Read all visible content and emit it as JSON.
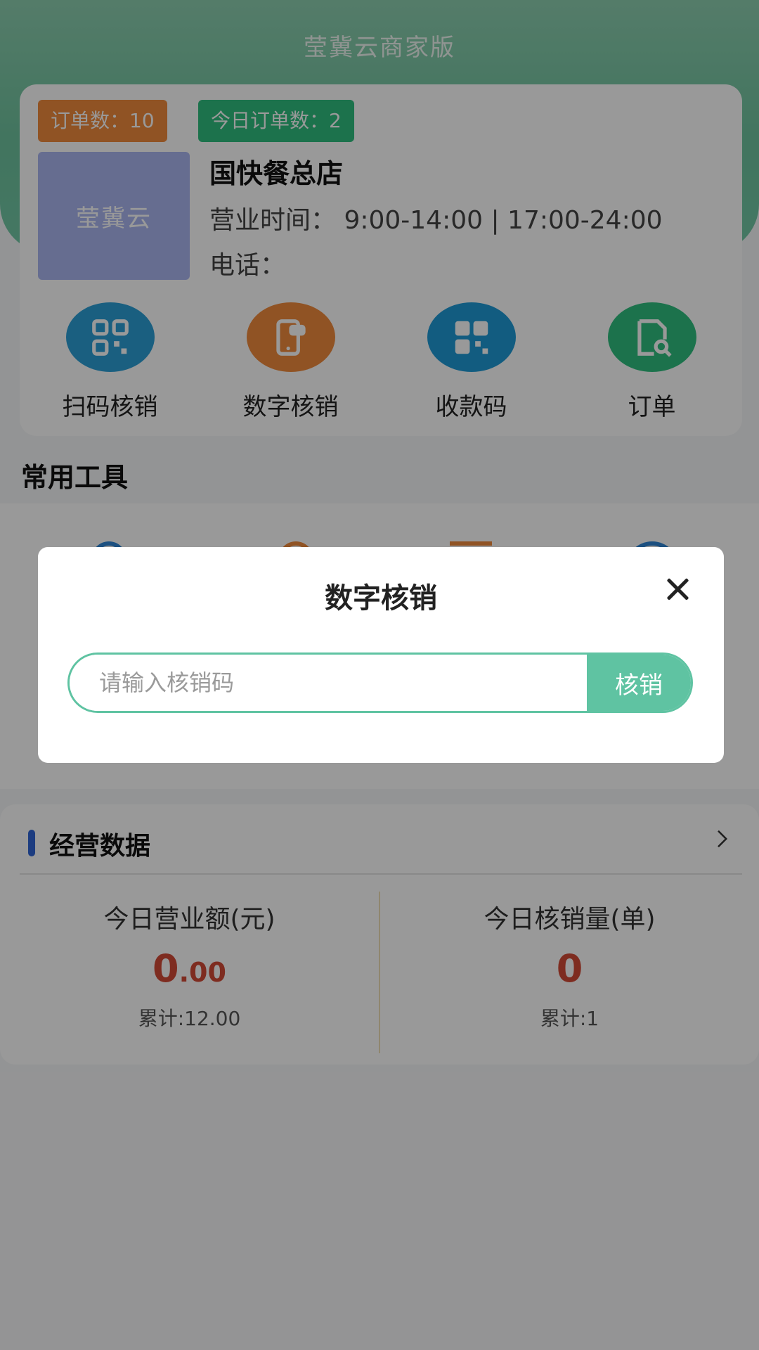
{
  "header": {
    "app_title": "莹冀云商家版"
  },
  "store": {
    "order_count_badge": "订单数：10",
    "today_order_badge": "今日订单数：2",
    "logo_text": "莹冀云",
    "name": "国快餐总店",
    "hours": "营业时间：  9:00-14:00  |  17:00-24:00",
    "phone_label": "电话："
  },
  "actions": [
    {
      "label": "扫码核销",
      "color": "#2c9fd6"
    },
    {
      "label": "数字核销",
      "color": "#f08a3c"
    },
    {
      "label": "收款码",
      "color": "#1e9ad6"
    },
    {
      "label": "订单",
      "color": "#2fbf7f"
    }
  ],
  "tools": {
    "title": "常用工具"
  },
  "business": {
    "title": "经营数据",
    "revenue": {
      "label": "今日营业额(元)",
      "value_int": "0",
      "value_dec": ".00",
      "total": "累计:12.00"
    },
    "verify_count": {
      "label": "今日核销量(单)",
      "value": "0",
      "total": "累计:1"
    }
  },
  "modal": {
    "title": "数字核销",
    "input_placeholder": "请输入核销码",
    "submit_label": "核销"
  }
}
